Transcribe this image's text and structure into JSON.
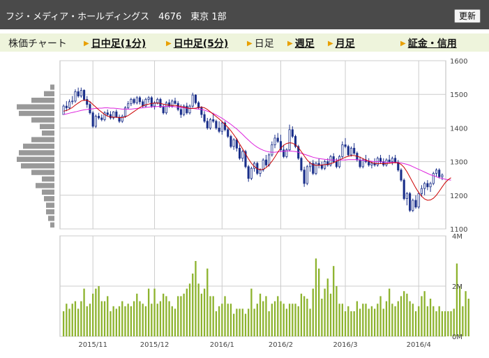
{
  "header": {
    "title": "フジ・メディア・ホールディングス　4676　東京 1部",
    "refresh_label": "更新"
  },
  "tabs": [
    {
      "label": "株価チャート",
      "link": false,
      "arrow": false
    },
    {
      "label": "日中足(1分)",
      "link": true,
      "arrow": true
    },
    {
      "label": "日中足(5分)",
      "link": true,
      "arrow": true
    },
    {
      "label": "日足",
      "link": false,
      "arrow": true
    },
    {
      "label": "週足",
      "link": true,
      "arrow": true
    },
    {
      "label": "月足",
      "link": true,
      "arrow": true
    },
    {
      "label": "証金・信用",
      "link": true,
      "arrow": true
    }
  ],
  "colors": {
    "up": "#ffffff",
    "down": "#1a2f8a",
    "candle_outline": "#1a2f8a",
    "ma_short": "#cc0000",
    "ma_long": "#dd22dd",
    "volume": "#8db32e",
    "profile": "#999999",
    "grid": "#cccccc",
    "tab_arrow": "#e8a000"
  },
  "chart_data": {
    "type": "candlestick",
    "price_axis": {
      "ticks": [
        "1600",
        "1500",
        "1400",
        "1300",
        "1200",
        "1100"
      ],
      "ylim": [
        1100,
        1600
      ]
    },
    "volume_axis": {
      "ticks": [
        "4M",
        "2M",
        "0M"
      ],
      "ylim": [
        0,
        4000000
      ]
    },
    "date_ticks": [
      "2015/11",
      "2015/12",
      "2016/1",
      "2016/2",
      "2016/3",
      "2016/4"
    ],
    "date_tick_index": [
      10,
      31,
      54,
      74,
      96,
      121
    ],
    "grid": true,
    "ohlc": [
      [
        1440,
        1470,
        1440,
        1465
      ],
      [
        1465,
        1480,
        1450,
        1460
      ],
      [
        1460,
        1485,
        1455,
        1478
      ],
      [
        1478,
        1495,
        1470,
        1480
      ],
      [
        1480,
        1515,
        1475,
        1508
      ],
      [
        1508,
        1520,
        1490,
        1495
      ],
      [
        1495,
        1520,
        1490,
        1512
      ],
      [
        1512,
        1515,
        1480,
        1485
      ],
      [
        1485,
        1495,
        1460,
        1470
      ],
      [
        1470,
        1480,
        1440,
        1445
      ],
      [
        1445,
        1450,
        1400,
        1405
      ],
      [
        1405,
        1440,
        1400,
        1435
      ],
      [
        1435,
        1445,
        1425,
        1430
      ],
      [
        1430,
        1440,
        1420,
        1425
      ],
      [
        1425,
        1450,
        1420,
        1445
      ],
      [
        1445,
        1455,
        1435,
        1440
      ],
      [
        1440,
        1450,
        1425,
        1430
      ],
      [
        1430,
        1450,
        1425,
        1448
      ],
      [
        1448,
        1455,
        1430,
        1432
      ],
      [
        1432,
        1440,
        1415,
        1420
      ],
      [
        1420,
        1440,
        1415,
        1435
      ],
      [
        1435,
        1465,
        1430,
        1460
      ],
      [
        1460,
        1480,
        1455,
        1472
      ],
      [
        1472,
        1490,
        1465,
        1485
      ],
      [
        1485,
        1490,
        1470,
        1475
      ],
      [
        1475,
        1495,
        1470,
        1490
      ],
      [
        1490,
        1495,
        1470,
        1478
      ],
      [
        1478,
        1485,
        1460,
        1465
      ],
      [
        1465,
        1490,
        1460,
        1485
      ],
      [
        1485,
        1495,
        1475,
        1490
      ],
      [
        1490,
        1495,
        1460,
        1465
      ],
      [
        1465,
        1480,
        1455,
        1475
      ],
      [
        1475,
        1490,
        1470,
        1485
      ],
      [
        1485,
        1490,
        1460,
        1462
      ],
      [
        1462,
        1470,
        1440,
        1445
      ],
      [
        1445,
        1480,
        1440,
        1475
      ],
      [
        1475,
        1485,
        1460,
        1465
      ],
      [
        1465,
        1485,
        1460,
        1480
      ],
      [
        1480,
        1490,
        1470,
        1473
      ],
      [
        1473,
        1480,
        1450,
        1455
      ],
      [
        1455,
        1470,
        1430,
        1440
      ],
      [
        1440,
        1470,
        1435,
        1465
      ],
      [
        1465,
        1475,
        1440,
        1445
      ],
      [
        1445,
        1470,
        1440,
        1465
      ],
      [
        1465,
        1505,
        1460,
        1498
      ],
      [
        1498,
        1500,
        1470,
        1475
      ],
      [
        1475,
        1480,
        1455,
        1460
      ],
      [
        1460,
        1465,
        1430,
        1440
      ],
      [
        1440,
        1450,
        1415,
        1420
      ],
      [
        1420,
        1430,
        1395,
        1400
      ],
      [
        1400,
        1430,
        1395,
        1425
      ],
      [
        1425,
        1445,
        1415,
        1420
      ],
      [
        1420,
        1425,
        1395,
        1400
      ],
      [
        1400,
        1420,
        1385,
        1390
      ],
      [
        1390,
        1420,
        1380,
        1415
      ],
      [
        1415,
        1420,
        1390,
        1395
      ],
      [
        1395,
        1400,
        1370,
        1375
      ],
      [
        1375,
        1380,
        1340,
        1345
      ],
      [
        1345,
        1370,
        1335,
        1365
      ],
      [
        1365,
        1370,
        1330,
        1340
      ],
      [
        1340,
        1350,
        1305,
        1310
      ],
      [
        1310,
        1335,
        1300,
        1330
      ],
      [
        1330,
        1335,
        1280,
        1285
      ],
      [
        1285,
        1290,
        1240,
        1250
      ],
      [
        1250,
        1285,
        1245,
        1280
      ],
      [
        1280,
        1300,
        1270,
        1295
      ],
      [
        1295,
        1300,
        1260,
        1265
      ],
      [
        1265,
        1280,
        1255,
        1275
      ],
      [
        1275,
        1310,
        1270,
        1305
      ],
      [
        1305,
        1320,
        1285,
        1290
      ],
      [
        1290,
        1325,
        1285,
        1320
      ],
      [
        1320,
        1360,
        1315,
        1350
      ],
      [
        1350,
        1380,
        1340,
        1370
      ],
      [
        1370,
        1385,
        1355,
        1360
      ],
      [
        1360,
        1380,
        1330,
        1335
      ],
      [
        1335,
        1350,
        1310,
        1315
      ],
      [
        1315,
        1340,
        1310,
        1335
      ],
      [
        1335,
        1410,
        1330,
        1395
      ],
      [
        1395,
        1405,
        1370,
        1375
      ],
      [
        1375,
        1380,
        1340,
        1345
      ],
      [
        1345,
        1350,
        1305,
        1310
      ],
      [
        1310,
        1315,
        1270,
        1275
      ],
      [
        1275,
        1285,
        1225,
        1235
      ],
      [
        1235,
        1290,
        1230,
        1285
      ],
      [
        1285,
        1300,
        1270,
        1295
      ],
      [
        1295,
        1305,
        1260,
        1265
      ],
      [
        1265,
        1300,
        1260,
        1295
      ],
      [
        1295,
        1310,
        1280,
        1290
      ],
      [
        1290,
        1300,
        1275,
        1280
      ],
      [
        1280,
        1305,
        1275,
        1300
      ],
      [
        1300,
        1310,
        1285,
        1290
      ],
      [
        1290,
        1320,
        1285,
        1315
      ],
      [
        1315,
        1325,
        1295,
        1300
      ],
      [
        1300,
        1310,
        1280,
        1285
      ],
      [
        1285,
        1320,
        1280,
        1315
      ],
      [
        1315,
        1360,
        1310,
        1350
      ],
      [
        1350,
        1370,
        1340,
        1345
      ],
      [
        1345,
        1350,
        1315,
        1320
      ],
      [
        1320,
        1345,
        1315,
        1340
      ],
      [
        1340,
        1355,
        1320,
        1325
      ],
      [
        1325,
        1330,
        1300,
        1305
      ],
      [
        1305,
        1315,
        1280,
        1285
      ],
      [
        1285,
        1310,
        1280,
        1305
      ],
      [
        1305,
        1320,
        1295,
        1300
      ],
      [
        1300,
        1310,
        1285,
        1290
      ],
      [
        1290,
        1300,
        1280,
        1295
      ],
      [
        1295,
        1310,
        1285,
        1290
      ],
      [
        1290,
        1315,
        1285,
        1310
      ],
      [
        1310,
        1320,
        1295,
        1300
      ],
      [
        1300,
        1310,
        1285,
        1290
      ],
      [
        1290,
        1310,
        1285,
        1305
      ],
      [
        1305,
        1320,
        1295,
        1300
      ],
      [
        1300,
        1315,
        1290,
        1310
      ],
      [
        1310,
        1320,
        1295,
        1298
      ],
      [
        1298,
        1305,
        1270,
        1275
      ],
      [
        1275,
        1280,
        1240,
        1245
      ],
      [
        1245,
        1250,
        1185,
        1190
      ],
      [
        1190,
        1210,
        1170,
        1205
      ],
      [
        1205,
        1210,
        1150,
        1155
      ],
      [
        1155,
        1190,
        1150,
        1185
      ],
      [
        1185,
        1200,
        1160,
        1165
      ],
      [
        1165,
        1210,
        1160,
        1205
      ],
      [
        1205,
        1230,
        1195,
        1220
      ],
      [
        1220,
        1240,
        1200,
        1235
      ],
      [
        1235,
        1245,
        1215,
        1225
      ],
      [
        1225,
        1240,
        1210,
        1235
      ],
      [
        1235,
        1270,
        1230,
        1265
      ],
      [
        1265,
        1280,
        1255,
        1275
      ],
      [
        1275,
        1280,
        1250,
        1255
      ],
      [
        1255,
        1265,
        1245,
        1260
      ]
    ],
    "ma_short": [
      1450,
      1452,
      1456,
      1461,
      1468,
      1474,
      1480,
      1483,
      1482,
      1478,
      1470,
      1462,
      1454,
      1447,
      1440,
      1435,
      1433,
      1432,
      1432,
      1431,
      1431,
      1433,
      1437,
      1443,
      1449,
      1455,
      1461,
      1466,
      1469,
      1471,
      1473,
      1474,
      1474,
      1473,
      1471,
      1469,
      1468,
      1467,
      1467,
      1466,
      1464,
      1462,
      1460,
      1458,
      1458,
      1459,
      1461,
      1462,
      1460,
      1455,
      1448,
      1441,
      1434,
      1427,
      1419,
      1411,
      1402,
      1392,
      1380,
      1367,
      1352,
      1338,
      1323,
      1308,
      1295,
      1285,
      1279,
      1276,
      1277,
      1282,
      1290,
      1301,
      1314,
      1328,
      1340,
      1349,
      1354,
      1356,
      1355,
      1350,
      1342,
      1330,
      1317,
      1305,
      1296,
      1291,
      1289,
      1289,
      1290,
      1291,
      1292,
      1294,
      1297,
      1301,
      1305,
      1309,
      1313,
      1316,
      1318,
      1318,
      1316,
      1313,
      1309,
      1305,
      1301,
      1297,
      1295,
      1294,
      1294,
      1294,
      1294,
      1295,
      1296,
      1297,
      1296,
      1292,
      1283,
      1270,
      1254,
      1238,
      1222,
      1208,
      1197,
      1189,
      1185,
      1186,
      1191,
      1200,
      1212,
      1225,
      1237,
      1246,
      1252
    ],
    "ma_long": [
      1440,
      1442,
      1444,
      1446,
      1448,
      1450,
      1452,
      1454,
      1455,
      1456,
      1457,
      1458,
      1459,
      1459,
      1460,
      1460,
      1459,
      1459,
      1458,
      1457,
      1456,
      1456,
      1456,
      1456,
      1457,
      1458,
      1459,
      1460,
      1461,
      1462,
      1463,
      1463,
      1464,
      1464,
      1464,
      1464,
      1464,
      1464,
      1463,
      1462,
      1461,
      1460,
      1459,
      1458,
      1458,
      1457,
      1456,
      1455,
      1453,
      1450,
      1447,
      1443,
      1439,
      1434,
      1429,
      1423,
      1417,
      1411,
      1404,
      1397,
      1389,
      1381,
      1372,
      1364,
      1356,
      1349,
      1343,
      1338,
      1334,
      1331,
      1329,
      1328,
      1328,
      1329,
      1330,
      1331,
      1332,
      1332,
      1331,
      1330,
      1328,
      1325,
      1322,
      1319,
      1316,
      1313,
      1311,
      1309,
      1308,
      1307,
      1306,
      1305,
      1305,
      1305,
      1305,
      1305,
      1305,
      1306,
      1306,
      1306,
      1306,
      1305,
      1304,
      1303,
      1302,
      1301,
      1300,
      1300,
      1299,
      1299,
      1298,
      1298,
      1298,
      1298,
      1297,
      1296,
      1294,
      1292,
      1289,
      1285,
      1281,
      1277,
      1273,
      1269,
      1265,
      1261,
      1258,
      1255,
      1252,
      1250,
      1248,
      1246,
      1245
    ],
    "volume": [
      1.0,
      1.3,
      1.1,
      1.3,
      1.4,
      1.1,
      1.4,
      1.9,
      1.2,
      1.3,
      1.7,
      1.9,
      2.0,
      1.4,
      1.4,
      1.6,
      1.0,
      1.2,
      1.1,
      1.2,
      1.4,
      1.2,
      1.3,
      1.2,
      1.4,
      1.7,
      1.4,
      1.3,
      1.2,
      1.9,
      1.3,
      1.9,
      1.3,
      1.4,
      1.7,
      1.6,
      1.4,
      1.2,
      1.1,
      1.6,
      1.6,
      1.7,
      1.9,
      2.1,
      2.5,
      3.0,
      2.1,
      1.7,
      1.9,
      2.7,
      1.6,
      1.6,
      1.0,
      1.2,
      1.3,
      1.6,
      1.3,
      1.3,
      0.9,
      1.1,
      1.1,
      1.1,
      0.9,
      1.1,
      1.9,
      1.1,
      1.3,
      1.7,
      1.4,
      1.6,
      1.0,
      1.3,
      1.4,
      1.6,
      1.4,
      1.3,
      1.1,
      1.3,
      1.3,
      1.3,
      1.2,
      1.7,
      1.6,
      1.5,
      1.1,
      1.9,
      3.1,
      2.7,
      1.5,
      1.9,
      2.3,
      1.7,
      2.8,
      2.0,
      1.3,
      1.3,
      1.0,
      1.2,
      1.0,
      1.0,
      1.4,
      1.1,
      1.3,
      1.3,
      1.1,
      1.2,
      1.1,
      1.3,
      1.6,
      1.1,
      1.4,
      1.9,
      1.3,
      1.2,
      1.4,
      1.6,
      1.8,
      1.7,
      1.4,
      1.3,
      1.0,
      1.2,
      1.6,
      1.8,
      1.2,
      1.5,
      1.2,
      1.0,
      1.2,
      1.0,
      1.0,
      1.0,
      1.0,
      1.1,
      2.9,
      2.0,
      1.2,
      1.8,
      1.5
    ],
    "price_profile": [
      0.1,
      0.25,
      0.55,
      0.9,
      0.85,
      0.55,
      0.35,
      0.3,
      0.55,
      0.75,
      0.85,
      0.9,
      0.8,
      0.55,
      0.3,
      0.45,
      0.3,
      0.25,
      0.2,
      0.2,
      0.15,
      0.1
    ]
  }
}
